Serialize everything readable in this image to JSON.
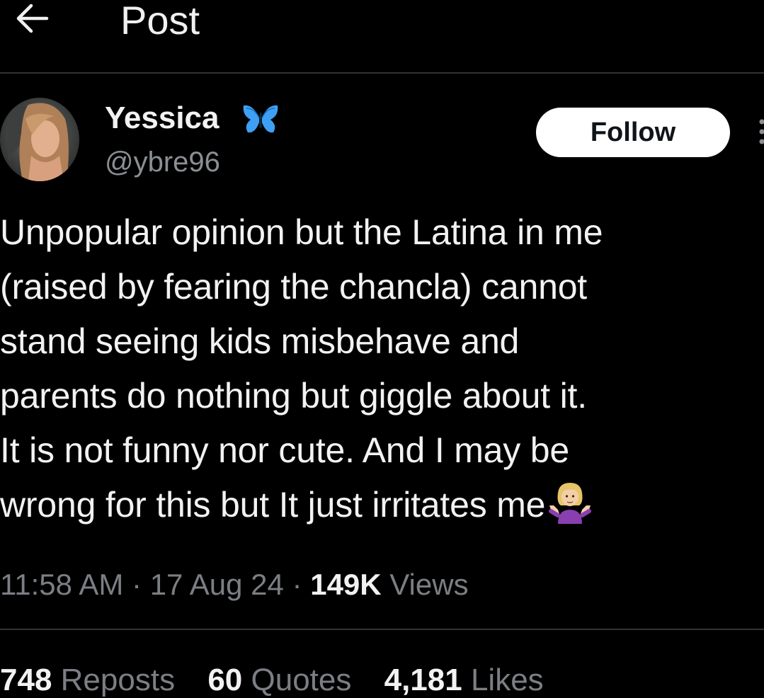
{
  "header": {
    "back_icon": "arrow-left-icon",
    "title": "Post"
  },
  "author": {
    "display_name": "Yessica",
    "badge_icon": "butterfly-emoji-icon",
    "badge_color": "#3ea0f5",
    "handle": "@ybre96",
    "follow_label": "Follow"
  },
  "post": {
    "lines": [
      "Unpopular opinion but the Latina in me",
      "(raised by fearing the chancla) cannot",
      "stand seeing kids misbehave and",
      "parents do nothing but giggle about it.",
      "It is not funny nor cute. And I may be",
      "wrong for this but It just irritates me"
    ],
    "trailing_emoji_icon": "woman-shrugging-emoji-icon"
  },
  "meta": {
    "time": "11:58 AM",
    "separator": "·",
    "date": "17 Aug 24",
    "views_count": "149K",
    "views_label": "Views"
  },
  "stats": {
    "reposts_count": "748",
    "reposts_label": "Reposts",
    "quotes_count": "60",
    "quotes_label": "Quotes",
    "likes_count": "4,181",
    "likes_label": "Likes"
  },
  "colors": {
    "background": "#000000",
    "text": "#f2f2f2",
    "muted": "#7b7f84",
    "divider": "#2f3336",
    "follow_bg": "#ffffff"
  }
}
